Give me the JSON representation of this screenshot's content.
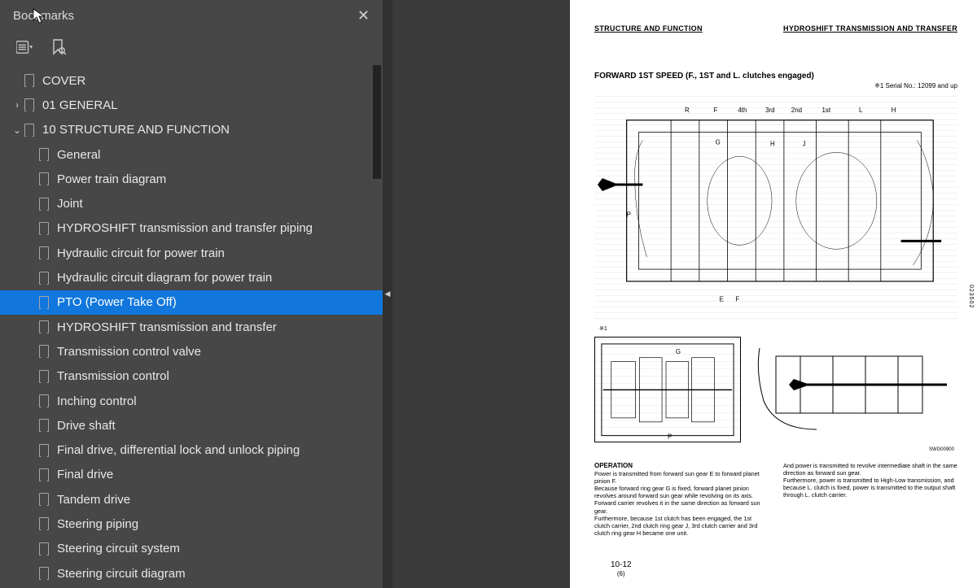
{
  "sidebar": {
    "title": "Bookmarks",
    "tree": [
      {
        "level": 0,
        "twisty": "",
        "label": "COVER"
      },
      {
        "level": 0,
        "twisty": "›",
        "label": "01 GENERAL"
      },
      {
        "level": 0,
        "twisty": "⌄",
        "label": "10 STRUCTURE AND FUNCTION"
      },
      {
        "level": 1,
        "twisty": "",
        "label": "General"
      },
      {
        "level": 1,
        "twisty": "",
        "label": "Power train diagram"
      },
      {
        "level": 1,
        "twisty": "",
        "label": "Joint"
      },
      {
        "level": 1,
        "twisty": "",
        "label": "HYDROSHIFT transmission and transfer piping"
      },
      {
        "level": 1,
        "twisty": "",
        "label": "Hydraulic circuit for power train"
      },
      {
        "level": 1,
        "twisty": "",
        "label": "Hydraulic circuit diagram for power train"
      },
      {
        "level": 1,
        "twisty": "",
        "label": "PTO (Power Take Off)",
        "selected": true
      },
      {
        "level": 1,
        "twisty": "",
        "label": "HYDROSHIFT transmission and transfer"
      },
      {
        "level": 1,
        "twisty": "",
        "label": "Transmission control valve"
      },
      {
        "level": 1,
        "twisty": "",
        "label": "Transmission control"
      },
      {
        "level": 1,
        "twisty": "",
        "label": "Inching control"
      },
      {
        "level": 1,
        "twisty": "",
        "label": "Drive shaft"
      },
      {
        "level": 1,
        "twisty": "",
        "label": "Final drive, differential lock and unlock piping"
      },
      {
        "level": 1,
        "twisty": "",
        "label": "Final drive"
      },
      {
        "level": 1,
        "twisty": "",
        "label": "Tandem drive"
      },
      {
        "level": 1,
        "twisty": "",
        "label": "Steering piping"
      },
      {
        "level": 1,
        "twisty": "",
        "label": "Steering circuit system"
      },
      {
        "level": 1,
        "twisty": "",
        "label": "Steering circuit diagram"
      }
    ]
  },
  "page": {
    "hdr_left": "STRUCTURE AND FUNCTION",
    "hdr_right": "HYDROSHIFT TRANSMISSION AND TRANSFER",
    "subtitle": "FORWARD 1ST SPEED (F., 1ST and L. clutches engaged)",
    "serial": "※1 Serial No.: 12099 and up",
    "side_code": "023502",
    "diag_code": "SWG00900",
    "op_title": "OPERATION",
    "op_col1": "Power is transmitted from forward sun gear E to forward planet pinion F.\nBecause forward ring gear G is fixed, forward planet pinion revolves around forward sun gear while revolving on its axis. Forward carrier revolves it in the same direction as forward sun gear.\nFurthermore, because 1st clutch has been engaged, the 1st clutch carrier, 2nd clutch ring gear J, 3rd clutch carrier and 3rd clutch ring gear H became one unit.",
    "op_col2": "And power is transmitted to revolve intermediate shaft in the same direction as forward sun gear.\nFurthermore, power is transmitted to High-Low transmission, and because L. clutch is fixed, power is transmitted to the output shaft through L. clutch carrier.",
    "pgnum": "10-12",
    "pgsub": "(6)"
  }
}
